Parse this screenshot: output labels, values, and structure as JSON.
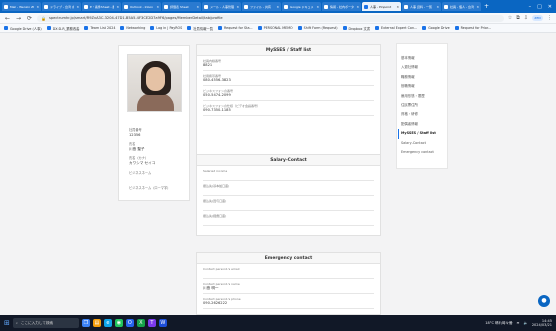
{
  "browser": {
    "tabs": [
      {
        "label": "Mail - Wenxin Zhou - Out"
      },
      {
        "label": "ドライブ - 台湾 (株)"
      },
      {
        "label": "E・案件Sheet - 翻訳"
      },
      {
        "label": "Outlook - Inbox"
      },
      {
        "label": "評価表 Sheet"
      },
      {
        "label": "メール - 人事管理"
      },
      {
        "label": "ファイル - 共有"
      },
      {
        "label": "Google ドキュメント"
      },
      {
        "label": "情報 - 社内ポータル"
      },
      {
        "label": "人事 - Pinpoint"
      },
      {
        "label": "人事 資料 - 一覧"
      },
      {
        "label": "社員 - 個人 - 台湾"
      }
    ],
    "new_tab": "+",
    "window_controls": {
      "minimize": "–",
      "maximize": "□",
      "close": "✕"
    },
    "url": "spectrumhr.jp/smart/R9ZvA3C-3204-47D1-B5A5-4F3CE2D7a9F6/pages/MemberDetail/tab/profile",
    "profile": "ZEN",
    "bookmarks": [
      "Google Drive (人事)",
      "DX:D-R_業務改善",
      "Team List 2024",
      "Networking",
      "Log in | PayROS",
      "社員情報一覧",
      "Request for Sta...",
      "PERSONAL MEMO",
      "Shift Form (Request)",
      "Dropbox 文書",
      "External Expert Con...",
      "Google Drive",
      "Request for Prior..."
    ]
  },
  "profile_card": {
    "fields": [
      {
        "label": "社員番号",
        "value": "12356"
      },
      {
        "label": "氏名",
        "value": "川島 聖子"
      },
      {
        "label": "氏名（カナ）",
        "value": "カワシマ セイコ"
      },
      {
        "label": "ビジネスネーム",
        "value": ""
      },
      {
        "label": "ビジネスネーム（ローマ字）",
        "value": ""
      }
    ]
  },
  "sections": {
    "mysses": {
      "title": "MySSES / Staff list",
      "rows": [
        {
          "label": "社員内線番号",
          "value": "8821"
        },
        {
          "label": "社用携帯番号",
          "value": "080-4556-3823"
        },
        {
          "label": "ビジネスフォンの番号",
          "value": "050-5474-2099"
        },
        {
          "label": "ビジネスフォンの仕様（ビデオ会議番号）",
          "value": "090-7350-1185"
        }
      ]
    },
    "salary": {
      "title": "Salary-Contact",
      "rows": [
        {
          "label": "Salaried income",
          "value": ""
        },
        {
          "label": "振込先(基本給口座)",
          "value": ""
        },
        {
          "label": "振込先(賞与口座)",
          "value": ""
        },
        {
          "label": "振込先(経費口座)",
          "value": ""
        }
      ]
    },
    "emergency": {
      "title": "Emergency contact",
      "rows": [
        {
          "label": "Contact person1's email",
          "value": ""
        },
        {
          "label": "Contact person1's name",
          "value": "川島 明一"
        },
        {
          "label": "Contact person1's phone",
          "value": "090-2626222"
        }
      ]
    }
  },
  "right_nav": {
    "items": [
      "基本情報",
      "入退社情報",
      "職務情報",
      "役職情報",
      "雇用形態・履歴",
      "住民票住所",
      "資格・研修",
      "配偶者情報",
      "MySSES / Staff list",
      "Salary-Contact",
      "Emergency contact"
    ],
    "active_index": 8
  },
  "fab": {
    "label": "●"
  },
  "taskbar": {
    "search_placeholder": "ここに入力して検索",
    "weather": "18°C 晴れ時々曇",
    "time": "14:45",
    "date": "2024/03/21"
  }
}
